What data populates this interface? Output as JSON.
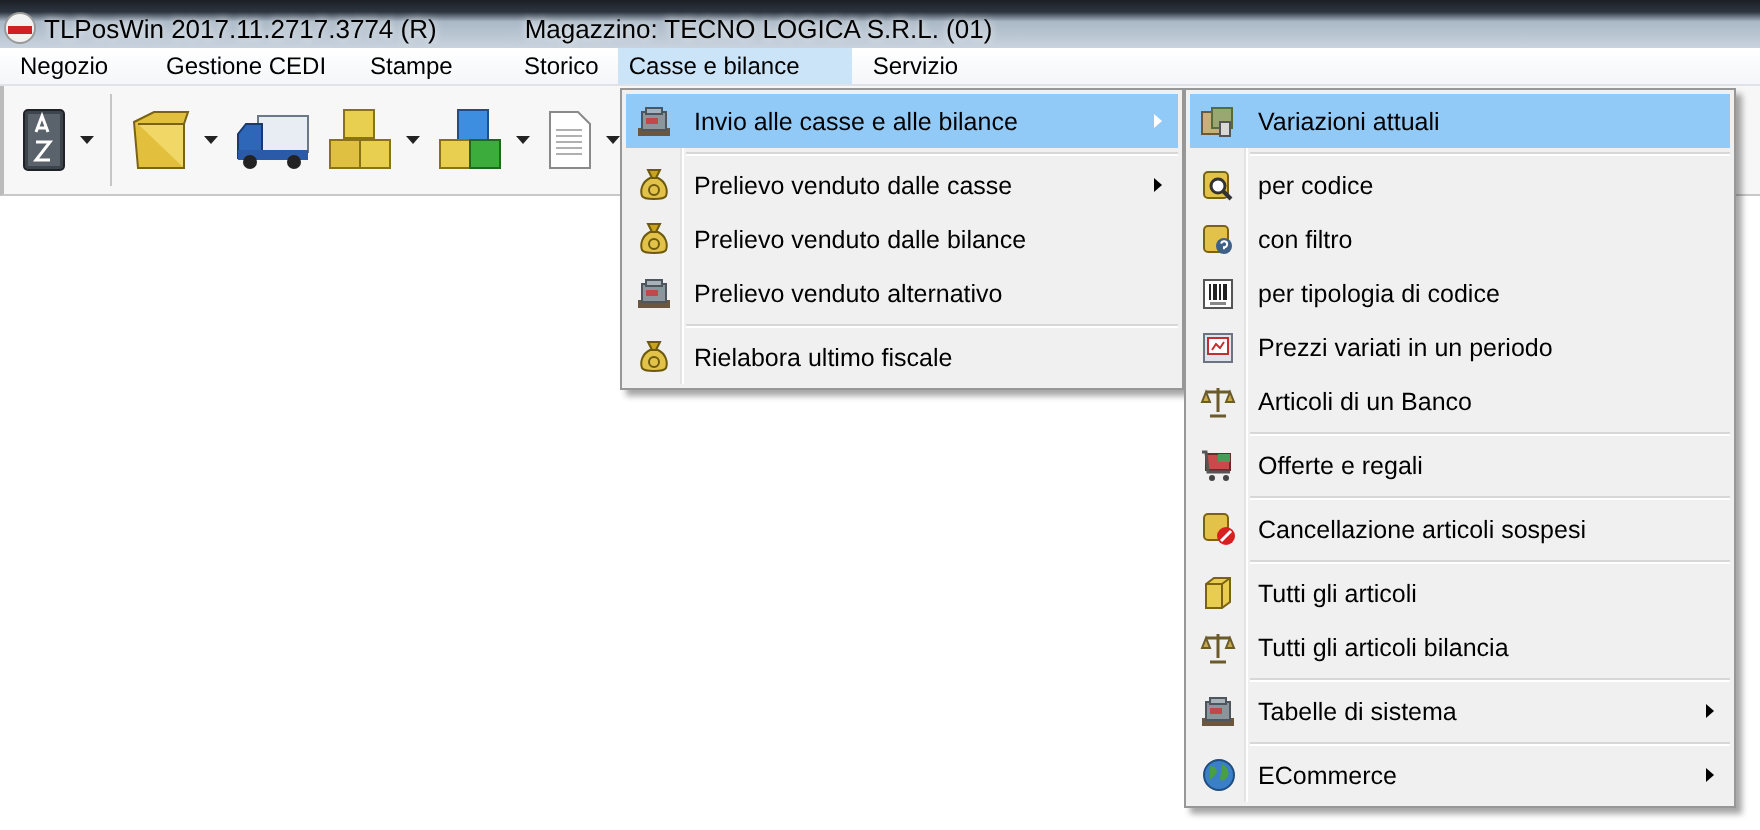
{
  "window": {
    "title": "TLPosWin 2017.11.2717.3774 (R)",
    "warehouse": "Magazzino: TECNO LOGICA S.R.L. (01)"
  },
  "menubar": [
    {
      "label": "Negozio",
      "selected": false
    },
    {
      "label": "Gestione CEDI",
      "selected": false
    },
    {
      "label": "Stampe",
      "selected": false
    },
    {
      "label": "Storico",
      "selected": false
    },
    {
      "label": "Casse e bilance",
      "selected": true
    },
    {
      "label": "Servizio",
      "selected": false
    }
  ],
  "toolbar": [
    {
      "kind": "button",
      "dropdown": true
    },
    {
      "kind": "separator"
    },
    {
      "kind": "button",
      "dropdown": true
    },
    {
      "kind": "button",
      "dropdown": false
    },
    {
      "kind": "button",
      "dropdown": true
    },
    {
      "kind": "button",
      "dropdown": true
    },
    {
      "kind": "button",
      "dropdown": true
    }
  ],
  "menu": [
    {
      "kind": "item",
      "label": "Invio alle casse e alle bilance",
      "selected": true,
      "submenu": true
    },
    {
      "kind": "separator"
    },
    {
      "kind": "item",
      "label": "Prelievo venduto dalle casse",
      "selected": false,
      "submenu": true
    },
    {
      "kind": "item",
      "label": "Prelievo venduto dalle bilance",
      "selected": false,
      "submenu": false
    },
    {
      "kind": "item",
      "label": "Prelievo venduto alternativo",
      "selected": false,
      "submenu": false
    },
    {
      "kind": "separator"
    },
    {
      "kind": "item",
      "label": "Rielabora ultimo fiscale",
      "selected": false,
      "submenu": false
    }
  ],
  "submenu": [
    {
      "kind": "item",
      "label": "Variazioni attuali",
      "selected": true,
      "submenu": false
    },
    {
      "kind": "separator"
    },
    {
      "kind": "item",
      "label": "per codice",
      "selected": false,
      "submenu": false
    },
    {
      "kind": "item",
      "label": "con filtro",
      "selected": false,
      "submenu": false
    },
    {
      "kind": "item",
      "label": "per tipologia di codice",
      "selected": false,
      "submenu": false
    },
    {
      "kind": "item",
      "label": "Prezzi variati in un periodo",
      "selected": false,
      "submenu": false
    },
    {
      "kind": "item",
      "label": "Articoli di un Banco",
      "selected": false,
      "submenu": false
    },
    {
      "kind": "separator"
    },
    {
      "kind": "item",
      "label": "Offerte e regali",
      "selected": false,
      "submenu": false
    },
    {
      "kind": "separator"
    },
    {
      "kind": "item",
      "label": "Cancellazione articoli sospesi",
      "selected": false,
      "submenu": false
    },
    {
      "kind": "separator"
    },
    {
      "kind": "item",
      "label": "Tutti gli articoli",
      "selected": false,
      "submenu": false
    },
    {
      "kind": "item",
      "label": "Tutti gli articoli bilancia",
      "selected": false,
      "submenu": false
    },
    {
      "kind": "separator"
    },
    {
      "kind": "item",
      "label": "Tabelle di sistema",
      "selected": false,
      "submenu": true
    },
    {
      "kind": "separator"
    },
    {
      "kind": "item",
      "label": "ECommerce",
      "selected": false,
      "submenu": true
    }
  ]
}
